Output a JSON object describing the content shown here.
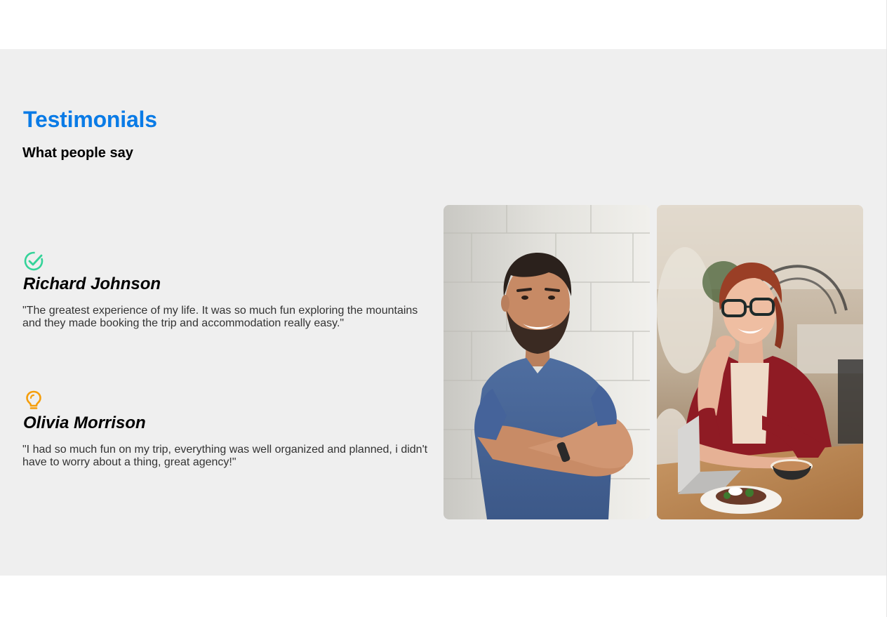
{
  "section": {
    "title": "Testimonials",
    "subtitle": "What people say"
  },
  "testimonials": [
    {
      "icon": "check-circle-icon",
      "icon_color": "#34d399",
      "name": "Richard Johnson",
      "quote": "\"The greatest experience of my life. It was so much fun exploring the mountains and they made booking the trip and accommodation really easy.\""
    },
    {
      "icon": "lightbulb-icon",
      "icon_color": "#f59e0b",
      "name": "Olivia Morrison",
      "quote": "\"I had so much fun on my trip, everything was well organized and planned, i didn't have to worry about a thing, great agency!\""
    }
  ],
  "photos": [
    {
      "subject": "smiling man in blue t-shirt with arms crossed against white brick wall"
    },
    {
      "subject": "smiling woman with glasses in red blazer at cafe table with laptop"
    }
  ],
  "colors": {
    "accent": "#0a7be6",
    "background": "#efefef"
  }
}
